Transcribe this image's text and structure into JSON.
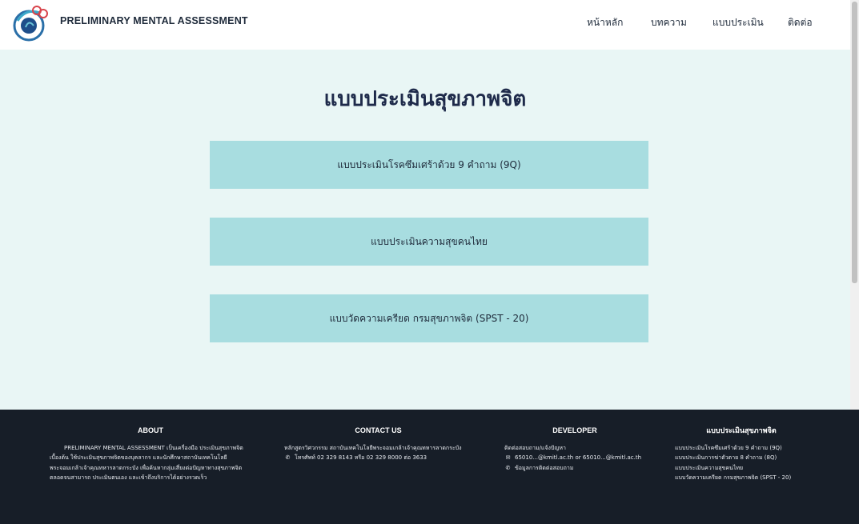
{
  "header": {
    "brand": "PRELIMINARY MENTAL ASSESSMENT",
    "nav": [
      "หน้าหลัก",
      "บทความ",
      "แบบประเมิน",
      "ติดต่อ"
    ]
  },
  "main": {
    "title": "แบบประเมินสุขภาพจิต",
    "cards": [
      "แบบประเมินโรคซึมเศร้าด้วย 9 คำถาม (9Q)",
      "แบบประเมินความสุขคนไทย",
      "แบบวัดความเครียด กรมสุขภาพจิต (SPST - 20)"
    ]
  },
  "footer": {
    "about": {
      "heading": "ABOUT",
      "text": "PRELIMINARY MENTAL ASSESSMENT เป็นเครื่องมือ ประเมินสุขภาพจิตเบื้องต้น ใช้ประเมินสุขภาพจิตของบุคลากร และนักศึกษาสถาบันเทคโนโลยีพระจอมเกล้าเจ้าคุณทหารลาดกระบัง เพื่อค้นหากลุ่มเสี่ยงต่อปัญหาทางสุขภาพจิต ตลอดจนสามารถ ประเมินตนเอง และเข้าถึงบริการได้อย่างรวดเร็ว"
    },
    "contact": {
      "heading": "CONTACT US",
      "address": "หลักสูตรวิศวกรรม สถาบันเทคโนโลยีพระจอมเกล้าเจ้าคุณทหารลาดกระบัง",
      "phone": "โทรศัพท์ 02 329 8143 หรือ 02 329 8000 ต่อ 3633"
    },
    "developer": {
      "heading": "DEVELOPER",
      "line1": "ติดต่อสอบถาม/แจ้งปัญหา",
      "email": "65010...@kmitl.ac.th or 65010...@kmitl.ac.th",
      "info": "ข้อมูลการติดต่อสอบถาม"
    },
    "assessments": {
      "heading": "แบบประเมินสุขภาพจิต",
      "items": [
        "แบบประเมินโรคซึมเศร้าด้วย 9 คำถาม (9Q)",
        "แบบประเมินการฆ่าตัวตาย 8 คำถาม (8Q)",
        "แบบประเมินความสุขคนไทย",
        "แบบวัดความเครียด กรมสุขภาพจิต (SPST - 20)"
      ]
    }
  },
  "colors": {
    "card_bg": "#a8dde0",
    "page_bg": "#e9f6f5",
    "footer_bg": "#171e28",
    "title": "#1e2a4a"
  },
  "icons": [
    "logo",
    "phone-icon",
    "mail-icon"
  ]
}
